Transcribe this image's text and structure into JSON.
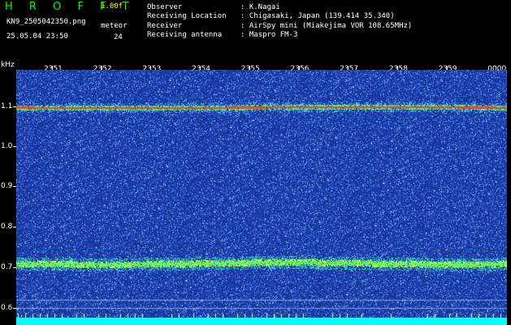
{
  "header": {
    "app_title": "H R O F F T",
    "version": "1.00f",
    "filename": "KN9_2505042350.png",
    "datetime": "25.05.04 23:50",
    "meteor_label": "meteor",
    "meteor_count": "24",
    "fields": [
      {
        "label": "Observer",
        "value": ": K.Nagai"
      },
      {
        "label": "Receiving Location",
        "value": ": Chigasaki, Japan (139.414 35.340)"
      },
      {
        "label": "Receiver",
        "value": ": AirSpy mini (Miakejima VOR 108.65MHz)"
      },
      {
        "label": "Receiving antenna",
        "value": ": Maspro FM-3"
      }
    ]
  },
  "spectrogram": {
    "unit": "kHz",
    "time_labels": [
      "2351",
      "2352",
      "2353",
      "2354",
      "2355",
      "2356",
      "2357",
      "2358",
      "2359",
      "0000"
    ],
    "freq_labels": [
      "1.1",
      "1.0",
      "0.9",
      "0.8",
      "0.7",
      "0.6"
    ],
    "colors": {
      "background": "#1a3fa8",
      "noise": "#4f8cff",
      "line_hot": "#ff3b1f",
      "line_mid": "#3fff60",
      "bottom_bar": "#00ffff"
    }
  }
}
